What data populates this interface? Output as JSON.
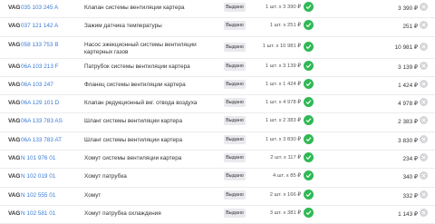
{
  "colors": {
    "accent_link": "#3a7bd5",
    "ok_green": "#2fb955",
    "badge_bg": "#e9e9ee"
  },
  "icons": {
    "available": "check-circle-icon",
    "remove": "close-circle-icon"
  },
  "rows": [
    {
      "brand": "VAG",
      "code": "035 103 245 A",
      "name": "Клапан системы вентиляции картера",
      "status": "Выдано",
      "qty": "1 шт. x 3 390 ₽",
      "total": "3 390 ₽"
    },
    {
      "brand": "VAG",
      "code": "037 121 142 A",
      "name": "Зажим датчика температуры",
      "status": "Выдано",
      "qty": "1 шт. x 251 ₽",
      "total": "251 ₽"
    },
    {
      "brand": "VAG",
      "code": "058 133 753 B",
      "name": "Насос эжекционный системы вентиляции картерных газов",
      "status": "Выдано",
      "qty": "1 шт. x 10 981 ₽",
      "total": "10 981 ₽"
    },
    {
      "brand": "VAG",
      "code": "06A 103 213 F",
      "name": "Патрубок системы вентиляции картера",
      "status": "Выдано",
      "qty": "1 шт. x 3 139 ₽",
      "total": "3 139 ₽"
    },
    {
      "brand": "VAG",
      "code": "06A 103 247",
      "name": "Фланец системы вентиляции картера",
      "status": "Выдано",
      "qty": "1 шт. x 1 424 ₽",
      "total": "1 424 ₽"
    },
    {
      "brand": "VAG",
      "code": "06A 129 101 D",
      "name": "Клапан редукционный вкг. отвода воздуха",
      "status": "Выдано",
      "qty": "1 шт. x 4 978 ₽",
      "total": "4 978 ₽"
    },
    {
      "brand": "VAG",
      "code": "06A 133 783 AS",
      "name": "Шланг системы вентиляции картера",
      "status": "Выдано",
      "qty": "1 шт. x 2 383 ₽",
      "total": "2 383 ₽"
    },
    {
      "brand": "VAG",
      "code": "06A 133 783 AT",
      "name": "Шланг системы вентиляции картера",
      "status": "Выдано",
      "qty": "1 шт. x 3 830 ₽",
      "total": "3 830 ₽"
    },
    {
      "brand": "VAG",
      "code": "N 101 976 01",
      "name": "Хомут системы вентиляции картера",
      "status": "Выдано",
      "qty": "2 шт. x 117 ₽",
      "total": "234 ₽"
    },
    {
      "brand": "VAG",
      "code": "N 102 019 01",
      "name": "Хомут патрубка",
      "status": "Выдано",
      "qty": "4 шт. x 85 ₽",
      "total": "340 ₽"
    },
    {
      "brand": "VAG",
      "code": "N 102 555 01",
      "name": "Хомут",
      "status": "Выдано",
      "qty": "2 шт. x 166 ₽",
      "total": "332 ₽"
    },
    {
      "brand": "VAG",
      "code": "N 102 581 01",
      "name": "Хомут патрубка охлаждения",
      "status": "Выдано",
      "qty": "3 шт. x 381 ₽",
      "total": "1 143 ₽"
    }
  ]
}
